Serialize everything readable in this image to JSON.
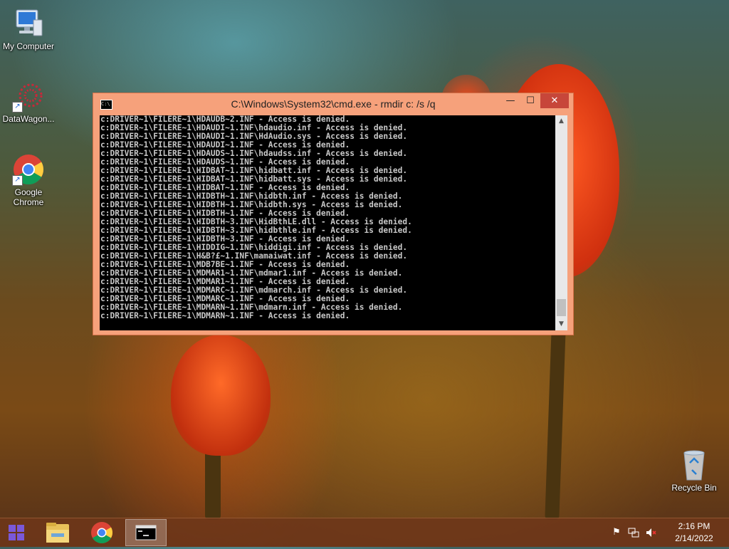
{
  "desktop": {
    "icons": [
      {
        "label": "My Computer"
      },
      {
        "label": "DataWagon..."
      },
      {
        "label": "Google Chrome"
      },
      {
        "label": "Recycle Bin"
      }
    ]
  },
  "cmd_window": {
    "title": "C:\\Windows\\System32\\cmd.exe - rmdir  c: /s /q",
    "minimize_glyph": "—",
    "maximize_glyph": "☐",
    "close_glyph": "✕",
    "lines": [
      "c:DRIVER~1\\FILERE~1\\HDAUDB~2.INF - Access is denied.",
      "c:DRIVER~1\\FILERE~1\\HDAUDI~1.INF\\hdaudio.inf - Access is denied.",
      "c:DRIVER~1\\FILERE~1\\HDAUDI~1.INF\\HdAudio.sys - Access is denied.",
      "c:DRIVER~1\\FILERE~1\\HDAUDI~1.INF - Access is denied.",
      "c:DRIVER~1\\FILERE~1\\HDAUDS~1.INF\\hdaudss.inf - Access is denied.",
      "c:DRIVER~1\\FILERE~1\\HDAUDS~1.INF - Access is denied.",
      "c:DRIVER~1\\FILERE~1\\HIDBAT~1.INF\\hidbatt.inf - Access is denied.",
      "c:DRIVER~1\\FILERE~1\\HIDBAT~1.INF\\hidbatt.sys - Access is denied.",
      "c:DRIVER~1\\FILERE~1\\HIDBAT~1.INF - Access is denied.",
      "c:DRIVER~1\\FILERE~1\\HIDBTH~1.INF\\hidbth.inf - Access is denied.",
      "c:DRIVER~1\\FILERE~1\\HIDBTH~1.INF\\hidbth.sys - Access is denied.",
      "c:DRIVER~1\\FILERE~1\\HIDBTH~1.INF - Access is denied.",
      "c:DRIVER~1\\FILERE~1\\HIDBTH~3.INF\\HidBthLE.dll - Access is denied.",
      "c:DRIVER~1\\FILERE~1\\HIDBTH~3.INF\\hidbthle.inf - Access is denied.",
      "c:DRIVER~1\\FILERE~1\\HIDBTH~3.INF - Access is denied.",
      "c:DRIVER~1\\FILERE~1\\HIDDIG~1.INF\\hiddigi.inf - Access is denied.",
      "c:DRIVER~1\\FILERE~1\\H&B?£~1.INF\\mamaiwat.inf - Access is denied.",
      "c:DRIVER~1\\FILERE~1\\MDB7BE~1.INF - Access is denied.",
      "c:DRIVER~1\\FILERE~1\\MDMAR1~1.INF\\mdmar1.inf - Access is denied.",
      "c:DRIVER~1\\FILERE~1\\MDMAR1~1.INF - Access is denied.",
      "c:DRIVER~1\\FILERE~1\\MDMARC~1.INF\\mdmarch.inf - Access is denied.",
      "c:DRIVER~1\\FILERE~1\\MDMARC~1.INF - Access is denied.",
      "c:DRIVER~1\\FILERE~1\\MDMARN~1.INF\\mdmarn.inf - Access is denied.",
      "c:DRIVER~1\\FILERE~1\\MDMARN~1.INF - Access is denied."
    ]
  },
  "taskbar": {
    "clock_time": "2:16 PM",
    "clock_date": "2/14/2022"
  },
  "colors": {
    "window_frame": "#f6a17b",
    "close_button": "#c7463a",
    "console_bg": "#000000",
    "console_text": "#c8c8c8"
  }
}
